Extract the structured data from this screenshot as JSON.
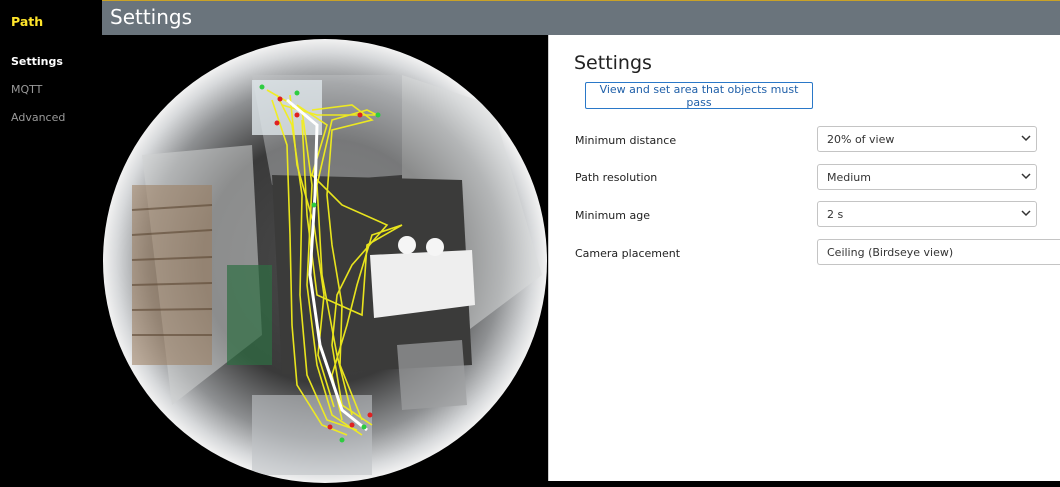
{
  "sidebar": {
    "app_title": "Path",
    "items": [
      {
        "label": "Settings",
        "active": true
      },
      {
        "label": "MQTT",
        "active": false
      },
      {
        "label": "Advanced",
        "active": false
      }
    ]
  },
  "header": {
    "title": "Settings"
  },
  "panel": {
    "title": "Settings",
    "area_button_label": "View and set area that objects must pass",
    "fields": [
      {
        "label": "Minimum distance",
        "value": "20% of view",
        "icon": "chevron-down-icon"
      },
      {
        "label": "Path resolution",
        "value": "Medium",
        "icon": "chevron-down-icon"
      },
      {
        "label": "Minimum age",
        "value": "2 s",
        "icon": "chevron-down-icon"
      },
      {
        "label": "Camera placement",
        "value": "Ceiling (Birdseye view)"
      }
    ]
  },
  "colors": {
    "accent": "#ffe52b",
    "header_bg": "#6a747c",
    "link_blue": "#2a78c8",
    "path_yellow": "#f2ee1c"
  }
}
